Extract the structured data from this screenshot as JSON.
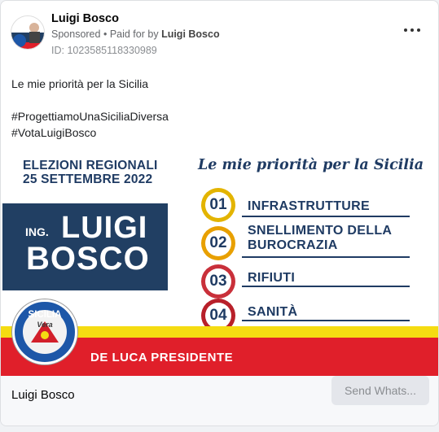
{
  "post": {
    "page_name": "Luigi Bosco",
    "sponsored_label": "Sponsored",
    "paid_for_prefix": "Paid for by",
    "paid_for_name": "Luigi Bosco",
    "ad_id": "ID: 1023585118330989",
    "body_text": "Le mie priorità per la Sicilia\n\n#ProgettiamoUnaSiciliaDiversa\n#VotaLuigiBosco"
  },
  "creative": {
    "elezioni_line1": "ELEZIONI REGIONALI",
    "elezioni_line2": "25 SETTEMBRE 2022",
    "ing_label": "ING.",
    "first_name": "LUIGI",
    "last_name": "BOSCO",
    "priorities_title": "Le mie priorità per la Sicilia",
    "priorities": [
      {
        "num": "01",
        "label": "INFRASTRUTTURE",
        "ring_color": "#e3b400"
      },
      {
        "num": "02",
        "label": "SNELLIMENTO DELLA\nBUROCRAZIA",
        "ring_color": "#e8a000"
      },
      {
        "num": "03",
        "label": "RIFIUTI",
        "ring_color": "#c9303a"
      },
      {
        "num": "04",
        "label": "SANITÀ",
        "ring_color": "#b8202a"
      }
    ],
    "footer_title": "DE LUCA PRESIDENTE",
    "logo_text": "SICILIA",
    "logo_subtext": "Vera"
  },
  "footer": {
    "page_name": "Luigi Bosco",
    "cta_label": "Send Whats..."
  },
  "colors": {
    "navy": "#1f3b63",
    "red": "#e01f2a",
    "yellow": "#f5dc12"
  }
}
